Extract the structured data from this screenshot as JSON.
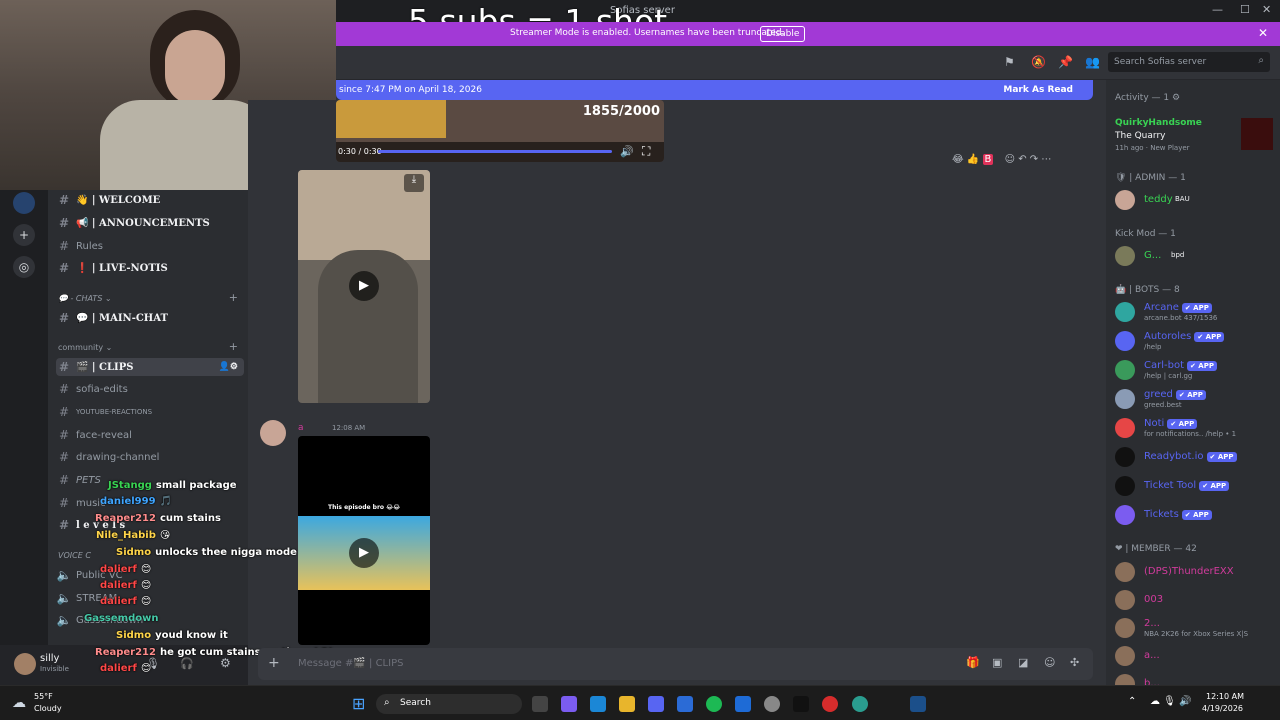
{
  "overlay": {
    "title": "5 subs = 1 shot"
  },
  "window": {
    "title": "Sofias server",
    "minimize": "—",
    "maximize": "☐",
    "close": "✕"
  },
  "banner": {
    "message": "Streamer Mode is enabled. Usernames have been truncated.",
    "disable_label": "Disable",
    "close": "✕"
  },
  "header": {
    "search_placeholder": "Search Sofias server",
    "search_icon": "⌕"
  },
  "newbar": {
    "left_text": "since 7:47 PM on April 18, 2026",
    "right_text": "Mark As Read"
  },
  "video1": {
    "counter": "1855/2000",
    "time": "0:30 / 0:30"
  },
  "message2": {
    "author": "a",
    "time": "12:08 AM",
    "caption": "This episode bro 😂😂"
  },
  "composer": {
    "placeholder": "Message #🎬 | CLIPS"
  },
  "sidebar": {
    "channels": [
      {
        "label": "👋 | WELCOME",
        "bright": true
      },
      {
        "label": "📢 | ANNOUNCEMENTS",
        "bright": true
      },
      {
        "label": "Rules",
        "bright": false
      },
      {
        "label": "❗ | LIVE-NOTIS",
        "bright": true
      }
    ],
    "cat_chats": "💬 - CHATS ⌄",
    "main_chat": "💬 | MAIN-CHAT",
    "cat_community": "community ⌄",
    "clips": "🎬 | CLIPS",
    "more": [
      {
        "label": "sofia-edits"
      },
      {
        "label": "YOUTUBE-REACTIONS"
      },
      {
        "label": "face-reveal"
      },
      {
        "label": "drawing-channel"
      },
      {
        "label": "PETS"
      },
      {
        "label": "music"
      },
      {
        "label": "l e v e l s"
      }
    ],
    "cat_voice": "VOICE C",
    "voice": [
      "Public VC",
      "STREAM",
      "Gassemdown"
    ]
  },
  "user": {
    "name": "silly",
    "status": "Invisible"
  },
  "chat": [
    {
      "name": "JStangg",
      "text": "small package",
      "color": "#39d353"
    },
    {
      "name": "daniel999",
      "text": "🎵",
      "color": "#3fa5ff"
    },
    {
      "name": "Reaper212",
      "text": "cum stains",
      "color": "#ff8c8c"
    },
    {
      "name": "Nile_Habib",
      "text": "😘",
      "color": "#ffd54a"
    },
    {
      "name": "Sidmo",
      "text": "unlocks thee nigga mode",
      "color": "#ffd54a"
    },
    {
      "name": "dalierf",
      "text": "😊",
      "color": "#ff4747"
    },
    {
      "name": "dalierf",
      "text": "😊",
      "color": "#ff4747"
    },
    {
      "name": "dalierf",
      "text": "😊",
      "color": "#ff4747"
    },
    {
      "name": "Gassemdown",
      "text": "",
      "color": "#46c9a8"
    },
    {
      "name": "Sidmo",
      "text": "youd know it",
      "color": "#ffd54a"
    },
    {
      "name": "Reaper212",
      "text": "he got cum stains on them LOL",
      "color": "#ff8c8c"
    },
    {
      "name": "dalierf",
      "text": "😊",
      "color": "#ff4747"
    }
  ],
  "members": {
    "activity_label": "Activity — 1 ⚙",
    "activity_user": "QuirkyHandsome",
    "activity_game": "The Quarry",
    "activity_meta": "11h ago · New Player",
    "admin_label": "🛡 | ADMIN — 1",
    "admin_user": "teddy",
    "admin_tag": "BAU",
    "kickmod_label": "Kick Mod — 1",
    "kickmod_user": "G...",
    "kickmod_tag": "bpd",
    "bots_label": "🤖 | BOTS — 8",
    "bots": [
      {
        "name": "Arcane",
        "sub": "arcane.bot 437/1536",
        "color": "#2fa6a0"
      },
      {
        "name": "Autoroles",
        "sub": "/help",
        "color": "#5865f2"
      },
      {
        "name": "Carl-bot",
        "sub": "/help | carl.gg",
        "color": "#3a9a5b"
      },
      {
        "name": "greed",
        "sub": "greed.best",
        "color": "#8a9bb5"
      },
      {
        "name": "Noti",
        "sub": "for notifications.. /help • 1",
        "color": "#e64646"
      },
      {
        "name": "Readybot.io",
        "sub": "",
        "color": "#111111"
      },
      {
        "name": "Ticket Tool",
        "sub": "",
        "color": "#111111"
      },
      {
        "name": "Tickets",
        "sub": "",
        "color": "#7b5cf0"
      }
    ],
    "app_tag": "✔ APP",
    "member_label": "❤ | MEMBER — 42",
    "members": [
      {
        "name": "(DPS)ThunderEXX",
        "sub": "",
        "color": "#d13b9c"
      },
      {
        "name": "003",
        "sub": "",
        "color": "#d13b9c"
      },
      {
        "name": "2...",
        "sub": "NBA 2K26 for Xbox Series X|S",
        "color": "#d13b9c"
      },
      {
        "name": "a...",
        "sub": "",
        "color": "#d13b9c"
      },
      {
        "name": "b...",
        "sub": "",
        "color": "#d13b9c"
      }
    ]
  },
  "taskbar": {
    "temp": "55°F",
    "weather": "Cloudy",
    "search": "Search",
    "time": "12:10 AM",
    "date": "4/19/2026"
  }
}
